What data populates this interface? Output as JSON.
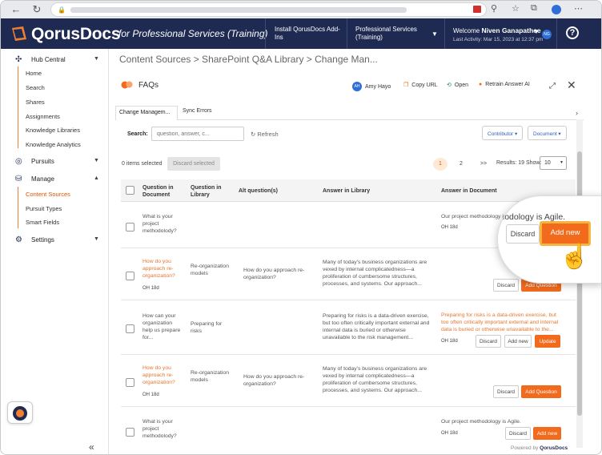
{
  "browser": {
    "nav_back": "←",
    "nav_refresh": "↻",
    "icons": [
      "lock-icon",
      "ext-icon",
      "star-icon",
      "collections-icon",
      "profile-icon",
      "menu-icon"
    ]
  },
  "header": {
    "brand": "QorusDocs",
    "brand_sub": "for Professional Services (Training)",
    "install": "Install QorusDocs Add-Ins",
    "workspace": "Professional Services (Training)",
    "welcome": "Welcome",
    "user": "Niven Ganapathee",
    "user_initials": "NG",
    "last_activity": "Last Activity: Mar 15, 2023 at 12:37 pm",
    "help": "?"
  },
  "sidebar": {
    "hub": "Hub Central",
    "hub_items": [
      "Home",
      "Search",
      "Shares",
      "Assignments",
      "Knowledge Libraries",
      "Knowledge Analytics"
    ],
    "pursuits": "Pursuits",
    "manage": "Manage",
    "manage_items": [
      "Content Sources",
      "Pursuit Types",
      "Smart Fields"
    ],
    "settings": "Settings",
    "collapse": "«"
  },
  "main": {
    "breadcrumb": "Content Sources > SharePoint Q&A Library > Change Man...",
    "faq_title": "FAQs",
    "toolbar": {
      "assignee_initials": "AH",
      "assignee": "Amy Hayo",
      "copy_url": "Copy URL",
      "open": "Open",
      "retrain": "Retrain Answer AI"
    },
    "tabs": [
      "Change Managem...",
      "Sync Errors"
    ],
    "search_label": "Search:",
    "search_placeholder": "question, answer, c...",
    "refresh": "Refresh",
    "contributor": "Contributor ▾",
    "document": "Document ▾",
    "items_selected": "0 items selected",
    "discard_selected": "Discard selected",
    "pages": [
      "1",
      "2",
      ">>"
    ],
    "results": "Results: 19  Show:",
    "page_size": "10"
  },
  "table": {
    "headers": [
      "Question in Document",
      "Question in Library",
      "Alt question(s)",
      "Answer in Library",
      "Answer in Document"
    ],
    "rows": [
      {
        "q_doc": "What is your project methodolody?",
        "q_doc_orange": false,
        "meta": "",
        "q_lib": "",
        "alt": "",
        "a_lib": "",
        "a_doc": "Our project methodology is Agile.",
        "a_doc_orange": false,
        "a_meta": "OH  18d",
        "buttons": [
          "Discard",
          "Add new"
        ]
      },
      {
        "q_doc": "How do you approach re-organization?",
        "q_doc_orange": true,
        "meta": "OH  18d",
        "q_lib": "Re-organization models",
        "alt": "How do you approach re-organization?",
        "a_lib": "Many of today's business organizations are vexed by internal complicatedness—a proliferation of cumbersome structures, processes, and systems. Our approach...",
        "a_doc": "",
        "a_doc_orange": false,
        "a_meta": "",
        "buttons": [
          "Discard",
          "Add Question"
        ]
      },
      {
        "q_doc": "How can your organization help us prepare for...",
        "q_doc_orange": false,
        "meta": "",
        "q_lib": "Preparing for risks",
        "alt": "",
        "a_lib": "Preparing for risks is a data-driven exercise, but too often critically important external and internal data is buried or otherwise unavailable to the risk management...",
        "a_doc": "Preparing for risks is a data-driven exercise, but too often critically important external and internal data is buried or otherwise unavailable to the...",
        "a_doc_orange": true,
        "a_meta": "OH  18d",
        "buttons": [
          "Discard",
          "Add new",
          "Update"
        ]
      },
      {
        "q_doc": "How do you approach re-organization?",
        "q_doc_orange": true,
        "meta": "OH  18d",
        "q_lib": "Re-organization models",
        "alt": "How do you approach re-organization?",
        "a_lib": "Many of today's business organizations are vexed by internal complicatedness—a proliferation of cumbersome structures, processes, and systems. Our approach...",
        "a_doc": "",
        "a_doc_orange": false,
        "a_meta": "",
        "buttons": [
          "Discard",
          "Add Question"
        ]
      },
      {
        "q_doc": "What is your project methodolody?",
        "q_doc_orange": false,
        "meta": "",
        "q_lib": "",
        "alt": "",
        "a_lib": "",
        "a_doc": "Our project methodology is Agile.",
        "a_doc_orange": false,
        "a_meta": "OH  18d",
        "buttons": [
          "Discard",
          "Add new"
        ]
      }
    ]
  },
  "magnifier": {
    "text": "Our project methodology is Agile.",
    "discard": "Discard",
    "add_new": "Add new"
  },
  "footer": {
    "powered": "Powered by",
    "brand": "QorusDocs"
  },
  "colors": {
    "navy": "#1e2a52",
    "orange": "#f26b1d",
    "accent_blue": "#2d5fbf"
  }
}
